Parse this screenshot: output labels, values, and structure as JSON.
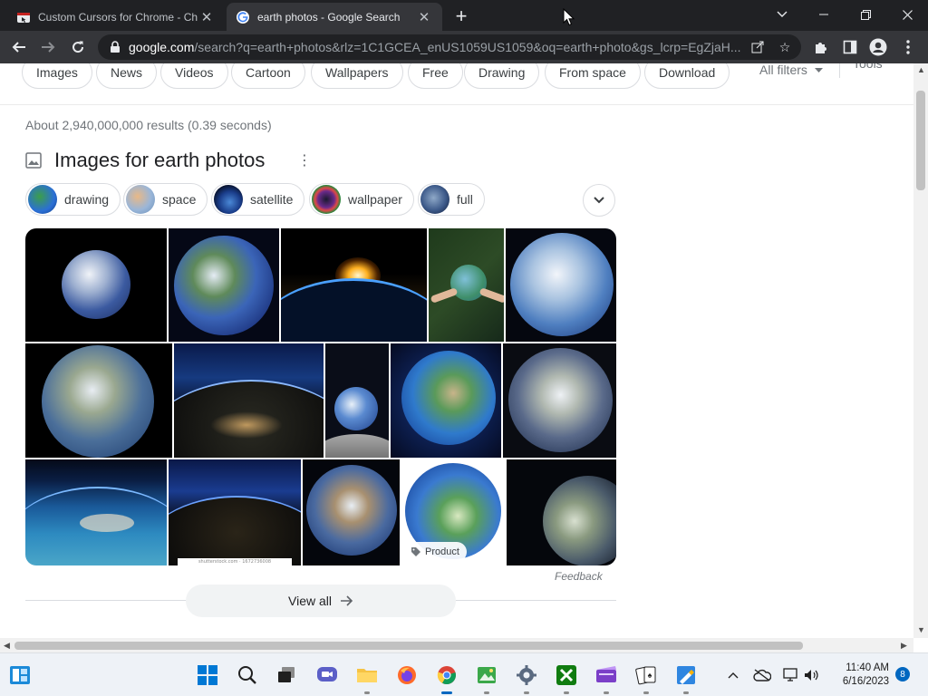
{
  "tabs": [
    {
      "title": "Custom Cursors for Chrome - Ch",
      "active": false
    },
    {
      "title": "earth photos - Google Search",
      "active": true
    }
  ],
  "window_controls": {
    "minimize": "—",
    "restore": "❐",
    "close": "✕",
    "dropdown": "⌄"
  },
  "address_bar": {
    "host": "google.com",
    "path": "/search?q=earth+photos&rlz=1C1GCEA_enUS1059US1059&oq=earth+photo&gs_lcrp=EgZjaH..."
  },
  "filter_chips": [
    "Images",
    "News",
    "Videos",
    "Cartoon",
    "Wallpapers",
    "Free",
    "Drawing",
    "From space",
    "Download"
  ],
  "all_filters": "All filters",
  "tools": "Tools",
  "result_stats": "About 2,940,000,000 results (0.39 seconds)",
  "images_section": {
    "title": "Images for earth photos",
    "related": [
      "drawing",
      "space",
      "satellite",
      "wallpaper",
      "full"
    ],
    "product_badge": "Product",
    "feedback": "Feedback",
    "view_all": "View all",
    "watermark": "shutterstock.com · 1672736008"
  },
  "taskbar": {
    "time": "11:40 AM",
    "date": "6/16/2023",
    "notifications": "8"
  },
  "colors": {
    "tab_strip": "#202124",
    "toolbar": "#35363a",
    "accent": "#0067c0"
  }
}
